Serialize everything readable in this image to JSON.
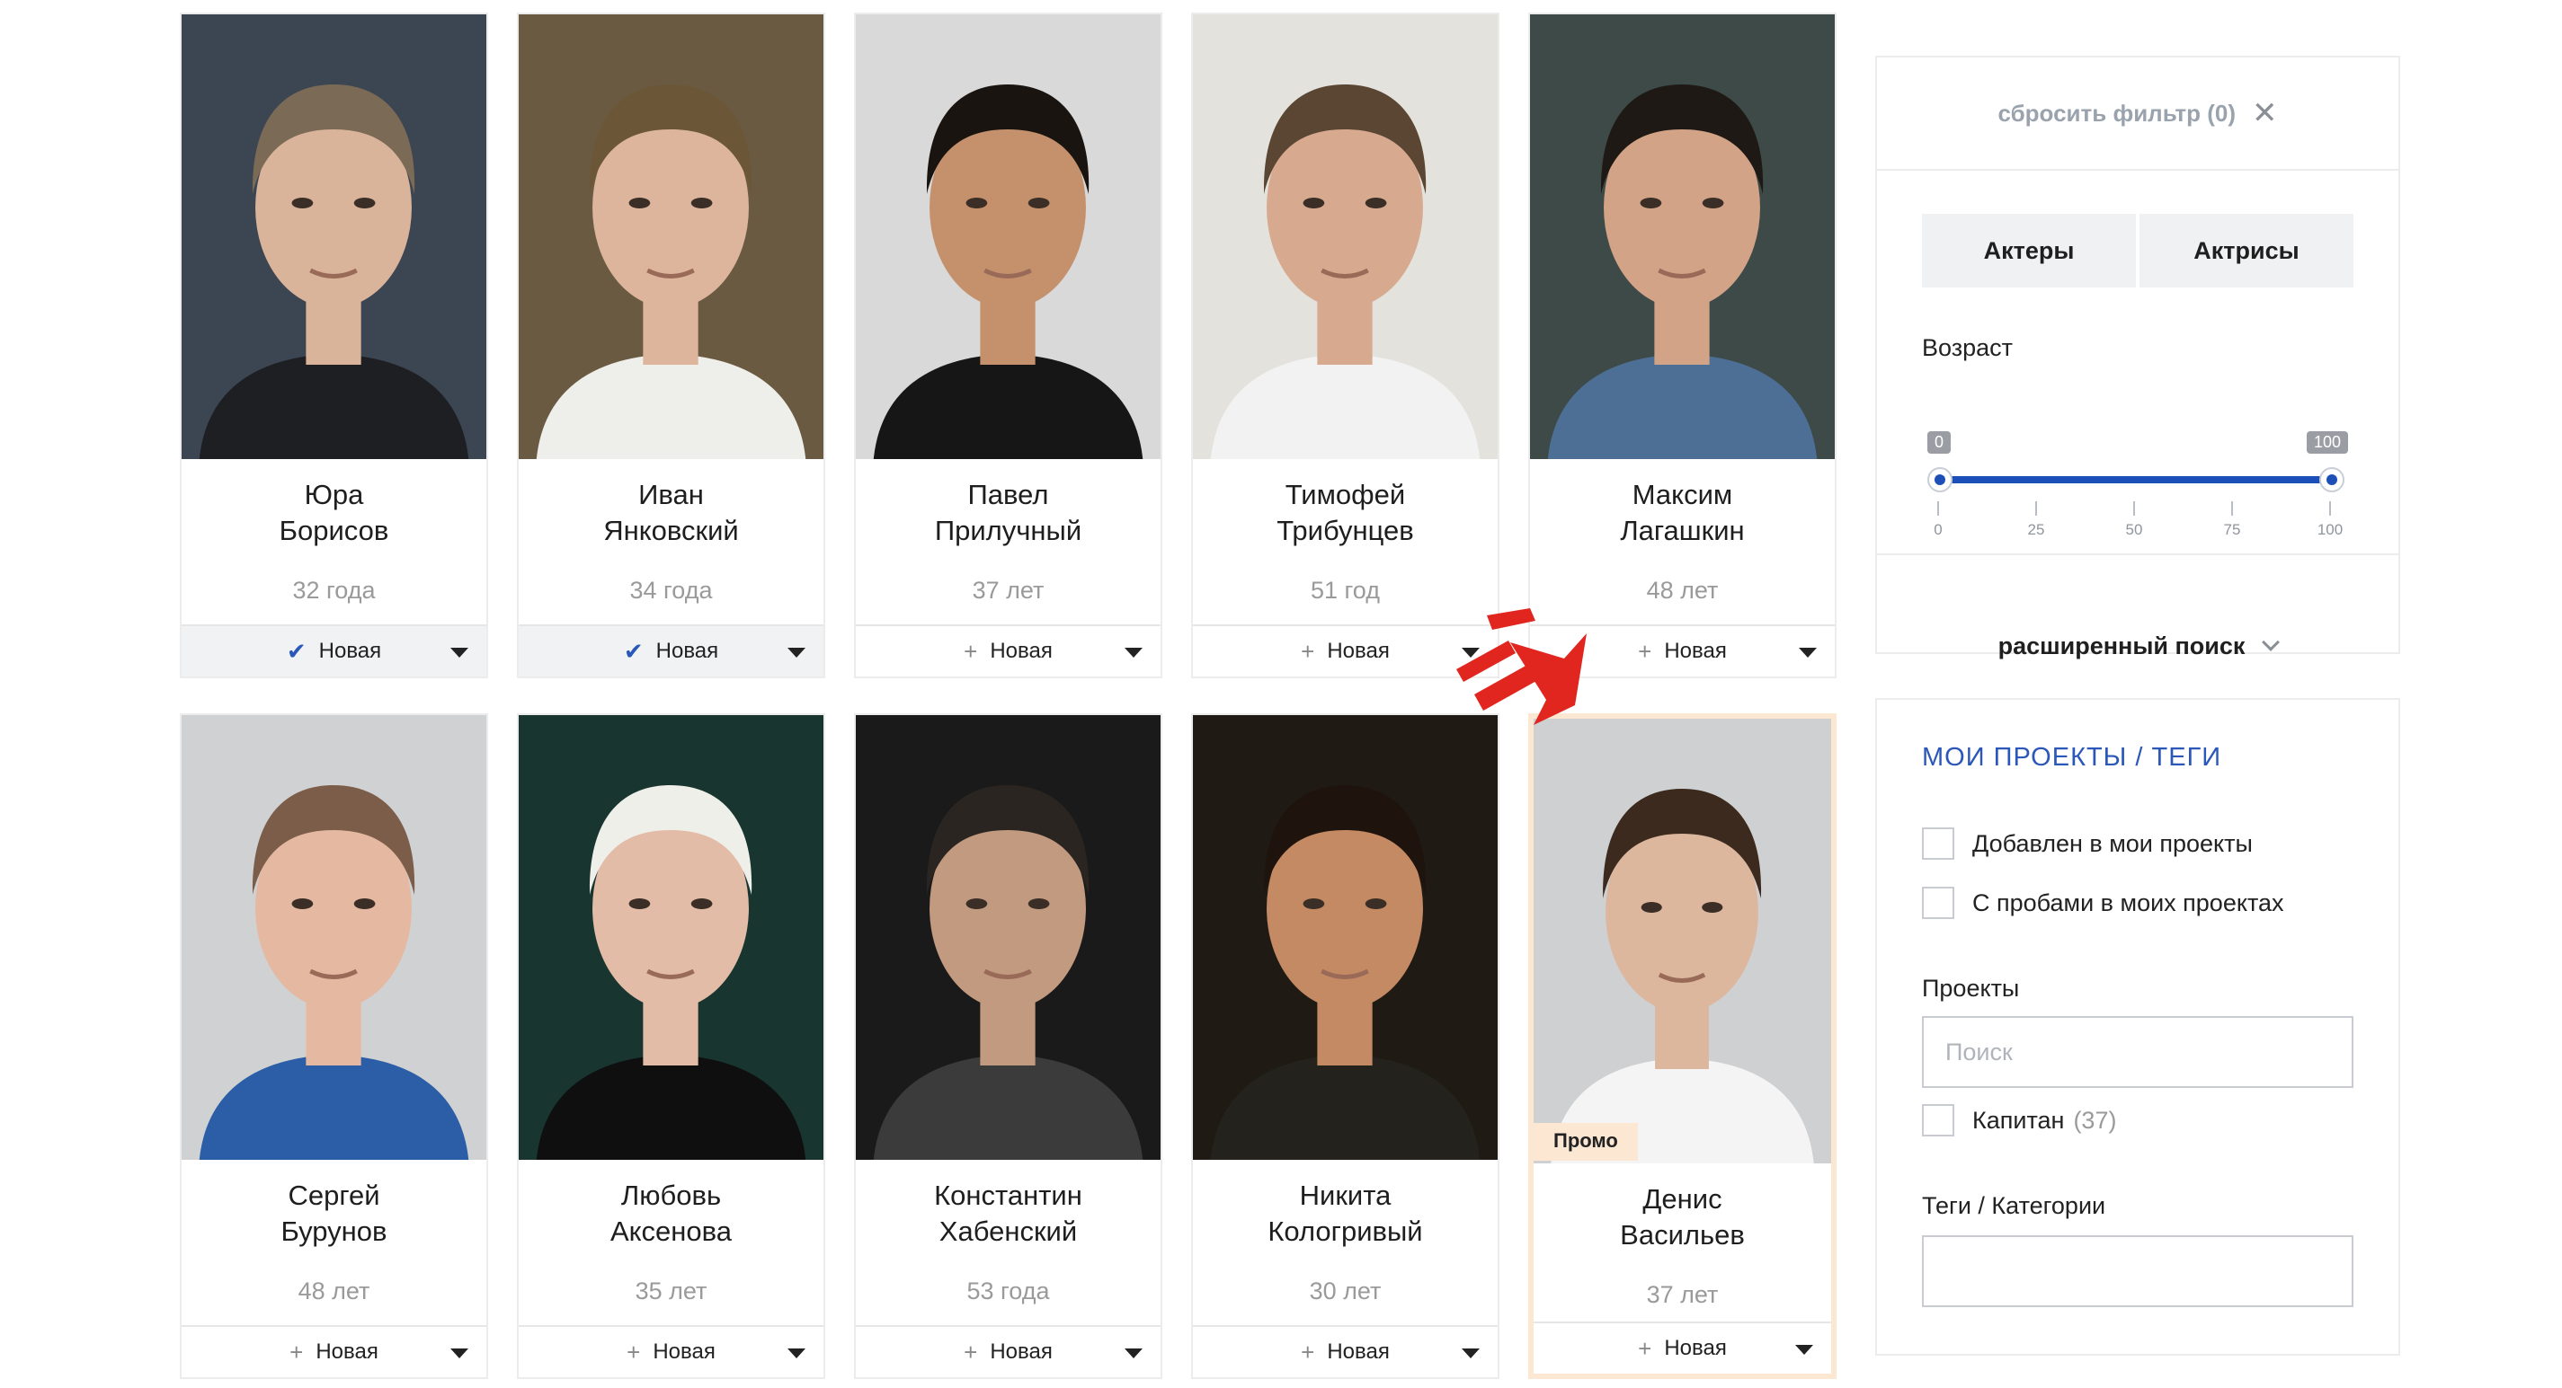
{
  "actors": [
    {
      "name_first": "Юра",
      "name_last": "Борисов",
      "age": "32 года",
      "action_label": "Новая",
      "status": "added",
      "promo": false,
      "colors": {
        "bg": "#3c4552",
        "shirt": "#1d1f22",
        "skin": "#d9b39a",
        "hair": "#7a6a56"
      }
    },
    {
      "name_first": "Иван",
      "name_last": "Янковский",
      "age": "34 года",
      "action_label": "Новая",
      "status": "added",
      "promo": false,
      "colors": {
        "bg": "#6b5a42",
        "shirt": "#eeeeea",
        "skin": "#dcb59c",
        "hair": "#6b5638"
      }
    },
    {
      "name_first": "Павел",
      "name_last": "Прилучный",
      "age": "37 лет",
      "action_label": "Новая",
      "status": "add",
      "promo": false,
      "colors": {
        "bg": "#d9d9d9",
        "shirt": "#161616",
        "skin": "#c4916c",
        "hair": "#1a1410"
      }
    },
    {
      "name_first": "Тимофей",
      "name_last": "Трибунцев",
      "age": "51 год",
      "action_label": "Новая",
      "status": "add",
      "promo": false,
      "colors": {
        "bg": "#e4e2dc",
        "shirt": "#f2f2f2",
        "skin": "#d7aa90",
        "hair": "#5a4632"
      }
    },
    {
      "name_first": "Максим",
      "name_last": "Лагашкин",
      "age": "48 лет",
      "action_label": "Новая",
      "status": "add",
      "promo": false,
      "colors": {
        "bg": "#3d4a48",
        "shirt": "#4d6f96",
        "skin": "#d2a387",
        "hair": "#1e1914"
      }
    },
    {
      "name_first": "Сергей",
      "name_last": "Бурунов",
      "age": "48 лет",
      "action_label": "Новая",
      "status": "add",
      "promo": false,
      "colors": {
        "bg": "#cfd1d3",
        "shirt": "#2b5ea6",
        "skin": "#e5b9a1",
        "hair": "#7c5d49"
      }
    },
    {
      "name_first": "Любовь",
      "name_last": "Аксенова",
      "age": "35 лет",
      "action_label": "Новая",
      "status": "add",
      "promo": false,
      "colors": {
        "bg": "#193530",
        "shirt": "#0f0f0f",
        "skin": "#e3bca7",
        "hair": "#efefea"
      }
    },
    {
      "name_first": "Константин",
      "name_last": "Хабенский",
      "age": "53 года",
      "action_label": "Новая",
      "status": "add",
      "promo": false,
      "colors": {
        "bg": "#1a1a1a",
        "shirt": "#3b3b3b",
        "skin": "#c29a80",
        "hair": "#2a2520"
      }
    },
    {
      "name_first": "Никита",
      "name_last": "Кологривый",
      "age": "30 лет",
      "action_label": "Новая",
      "status": "add",
      "promo": false,
      "colors": {
        "bg": "#1f1a14",
        "shirt": "#23221c",
        "skin": "#c48a64",
        "hair": "#1e140d"
      }
    },
    {
      "name_first": "Денис",
      "name_last": "Васильев",
      "age": "37 лет",
      "action_label": "Новая",
      "status": "add",
      "promo": true,
      "promo_label": "Промо",
      "colors": {
        "bg": "#cfd0d1",
        "shirt": "#f4f4f4",
        "skin": "#ddb69e",
        "hair": "#3b2a1d"
      }
    }
  ],
  "filter": {
    "reset_label": "сбросить фильтр (0)",
    "tab_actors": "Актеры",
    "tab_actresses": "Актрисы",
    "age_label": "Возраст",
    "age_min": 0,
    "age_max": 100,
    "age_min_label": "0",
    "age_max_label": "100",
    "ticks": [
      "0",
      "25",
      "50",
      "75",
      "100"
    ],
    "advanced_label": "расширенный поиск"
  },
  "projects": {
    "title": "МОИ ПРОЕКТЫ / ТЕГИ",
    "added_label": "Добавлен в мои проекты",
    "tests_label": "С пробами в моих проектах",
    "projects_label": "Проекты",
    "search_placeholder": "Поиск",
    "project_item": "Капитан",
    "project_count": "(37)",
    "tags_label": "Теги / Категории"
  },
  "colors": {
    "accent": "#2a57b8",
    "promo": "#fbe7d2",
    "arrow": "#e0261f"
  }
}
